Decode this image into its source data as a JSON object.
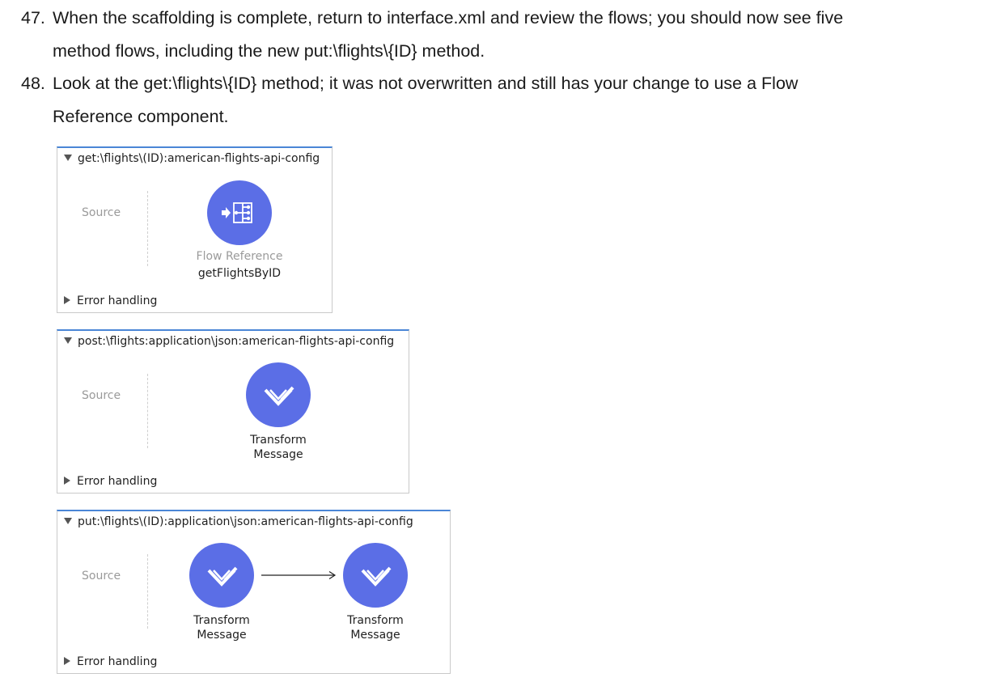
{
  "steps": [
    {
      "number": "47.",
      "line1": "When the scaffolding is complete, return to interface.xml and review the flows; you should now see five",
      "line2": "method flows, including the new put:\\flights\\{ID} method."
    },
    {
      "number": "48.",
      "line1": "Look at the get:\\flights\\{ID} method; it was not overwritten and still has your change to use a Flow",
      "line2": "Reference component."
    }
  ],
  "flows": [
    {
      "title": "get:\\flights\\(ID):american-flights-api-config",
      "source_label": "Source",
      "error_label": "Error handling",
      "components": [
        {
          "icon": "flow-reference-icon",
          "type_label": "Flow Reference",
          "name": "getFlightsByID"
        }
      ]
    },
    {
      "title": "post:\\flights:application\\json:american-flights-api-config",
      "source_label": "Source",
      "error_label": "Error handling",
      "components": [
        {
          "icon": "transform-message-icon",
          "line1": "Transform",
          "line2": "Message"
        }
      ]
    },
    {
      "title": "put:\\flights\\(ID):application\\json:american-flights-api-config",
      "source_label": "Source",
      "error_label": "Error handling",
      "components": [
        {
          "icon": "transform-message-icon",
          "line1": "Transform",
          "line2": "Message"
        },
        {
          "icon": "transform-message-icon",
          "line1": "Transform",
          "line2": "Message"
        }
      ]
    }
  ],
  "colors": {
    "component_fill": "#5b6ee6",
    "flow_top_border": "#4a86d6",
    "muted_text": "#9a9a9a"
  }
}
